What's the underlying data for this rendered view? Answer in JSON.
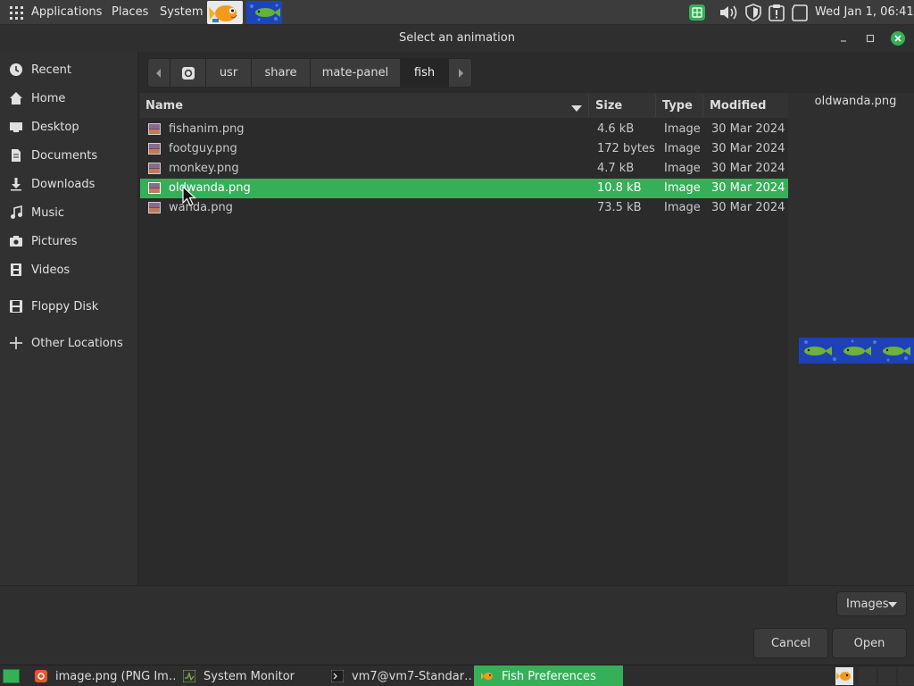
{
  "top_panel": {
    "menu": [
      "Applications",
      "Places",
      "System"
    ],
    "clock": "Wed Jan  1, 06:41"
  },
  "dialog": {
    "title": "Select an animation"
  },
  "sidebar": {
    "items": [
      {
        "label": "Recent",
        "icon": "clock-icon"
      },
      {
        "label": "Home",
        "icon": "home-icon"
      },
      {
        "label": "Desktop",
        "icon": "desktop-icon"
      },
      {
        "label": "Documents",
        "icon": "document-icon"
      },
      {
        "label": "Downloads",
        "icon": "download-icon"
      },
      {
        "label": "Music",
        "icon": "music-icon"
      },
      {
        "label": "Pictures",
        "icon": "camera-icon"
      },
      {
        "label": "Videos",
        "icon": "film-icon"
      },
      {
        "label": "Floppy Disk",
        "icon": "floppy-disk-icon"
      },
      {
        "label": "Other Locations",
        "icon": "plus-icon"
      }
    ]
  },
  "pathbar": {
    "crumbs": [
      "usr",
      "share",
      "mate-panel",
      "fish"
    ],
    "active_crumb": "fish"
  },
  "filelist": {
    "columns": {
      "name": "Name",
      "size": "Size",
      "type": "Type",
      "modified": "Modified"
    },
    "files": [
      {
        "name": "fishanim.png",
        "size": "4.6 kB",
        "type": "Image",
        "modified": "30 Mar 2024"
      },
      {
        "name": "footguy.png",
        "size": "172 bytes",
        "type": "Image",
        "modified": "30 Mar 2024"
      },
      {
        "name": "monkey.png",
        "size": "4.7 kB",
        "type": "Image",
        "modified": "30 Mar 2024"
      },
      {
        "name": "oldwanda.png",
        "size": "10.8 kB",
        "type": "Image",
        "modified": "30 Mar 2024"
      },
      {
        "name": "wanda.png",
        "size": "73.5 kB",
        "type": "Image",
        "modified": "30 Mar 2024"
      }
    ],
    "selected": "oldwanda.png"
  },
  "preview": {
    "filename": "oldwanda.png"
  },
  "footer": {
    "filter": "Images",
    "cancel": "Cancel",
    "open": "Open"
  },
  "taskbar": {
    "tasks": [
      {
        "label": "image.png (PNG Im…",
        "icon": "image-viewer-icon"
      },
      {
        "label": "System Monitor",
        "icon": "system-monitor-icon"
      },
      {
        "label": "vm7@vm7-Standar…",
        "icon": "terminal-icon"
      },
      {
        "label": "Fish Preferences",
        "icon": "fish-icon"
      }
    ],
    "active_task": "Fish Preferences"
  },
  "colors": {
    "accent": "#35b058",
    "panel": "#3c3c3c",
    "window": "#2b2b2b"
  }
}
